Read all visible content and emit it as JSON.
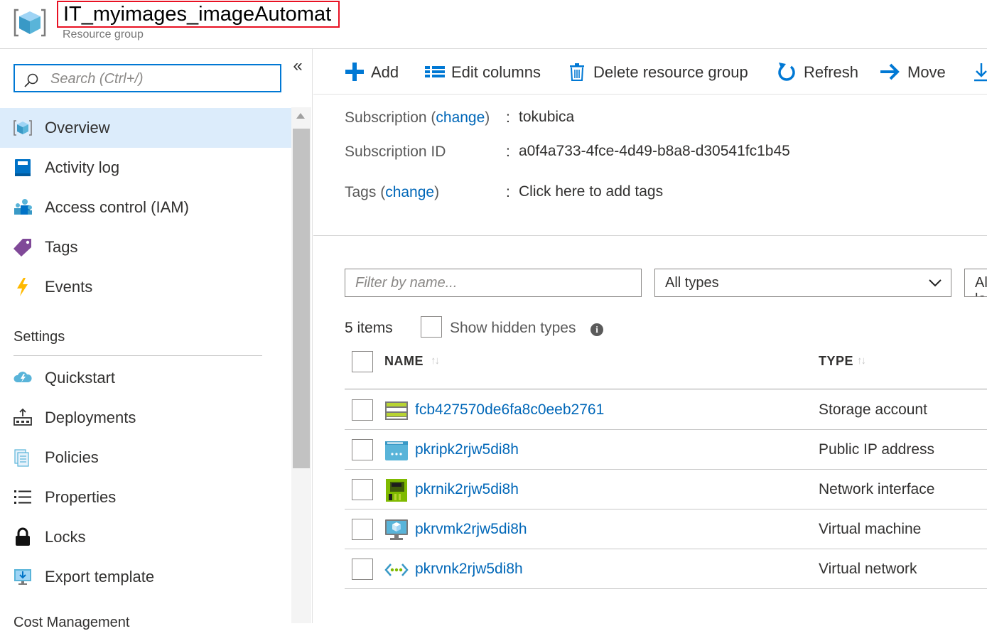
{
  "header": {
    "title": "IT_myimages_imageAutomat",
    "subtitle": "Resource group"
  },
  "sidebar": {
    "search_placeholder": "Search (Ctrl+/)",
    "collapse_glyph": "«",
    "items": [
      {
        "label": "Overview",
        "icon": "cube-icon",
        "active": true
      },
      {
        "label": "Activity log",
        "icon": "book-icon"
      },
      {
        "label": "Access control (IAM)",
        "icon": "people-icon"
      },
      {
        "label": "Tags",
        "icon": "tag-icon"
      },
      {
        "label": "Events",
        "icon": "lightning-icon"
      }
    ],
    "settings_heading": "Settings",
    "settings_items": [
      {
        "label": "Quickstart",
        "icon": "cloud-icon"
      },
      {
        "label": "Deployments",
        "icon": "deployments-icon"
      },
      {
        "label": "Policies",
        "icon": "policies-icon"
      },
      {
        "label": "Properties",
        "icon": "list-icon"
      },
      {
        "label": "Locks",
        "icon": "lock-icon"
      },
      {
        "label": "Export template",
        "icon": "monitor-export-icon"
      }
    ],
    "cost_heading": "Cost Management"
  },
  "toolbar": {
    "add": "Add",
    "edit_columns": "Edit columns",
    "delete_rg": "Delete resource group",
    "refresh": "Refresh",
    "move": "Move"
  },
  "essentials": {
    "subscription_label": "Subscription",
    "change_link": "change",
    "subscription_value": "tokubica",
    "subscription_id_label": "Subscription ID",
    "subscription_id_value": "a0f4a733-4fce-4d49-b8a8-d30541fc1b45",
    "tags_label": "Tags",
    "tags_value": "Click here to add tags",
    "colon": ":"
  },
  "filters": {
    "name_placeholder": "Filter by name...",
    "type_value": "All types",
    "location_value": "All locations"
  },
  "list": {
    "count": "5 items",
    "show_hidden": "Show hidden types",
    "info_glyph": "i",
    "col_name": "NAME",
    "col_type": "TYPE",
    "sort_glyph": "↑↓",
    "rows": [
      {
        "name": "fcb427570de6fa8c0eeb2761",
        "type": "Storage account",
        "icon": "storage-account-icon"
      },
      {
        "name": "pkripk2rjw5di8h",
        "type": "Public IP address",
        "icon": "public-ip-icon"
      },
      {
        "name": "pkrnik2rjw5di8h",
        "type": "Network interface",
        "icon": "network-interface-icon"
      },
      {
        "name": "pkrvmk2rjw5di8h",
        "type": "Virtual machine",
        "icon": "virtual-machine-icon"
      },
      {
        "name": "pkrvnk2rjw5di8h",
        "type": "Virtual network",
        "icon": "virtual-network-icon"
      }
    ]
  },
  "colors": {
    "accent": "#0078d4",
    "link": "#0067b8",
    "active_nav": "#dcecfb",
    "highlight_border": "#e81123"
  }
}
